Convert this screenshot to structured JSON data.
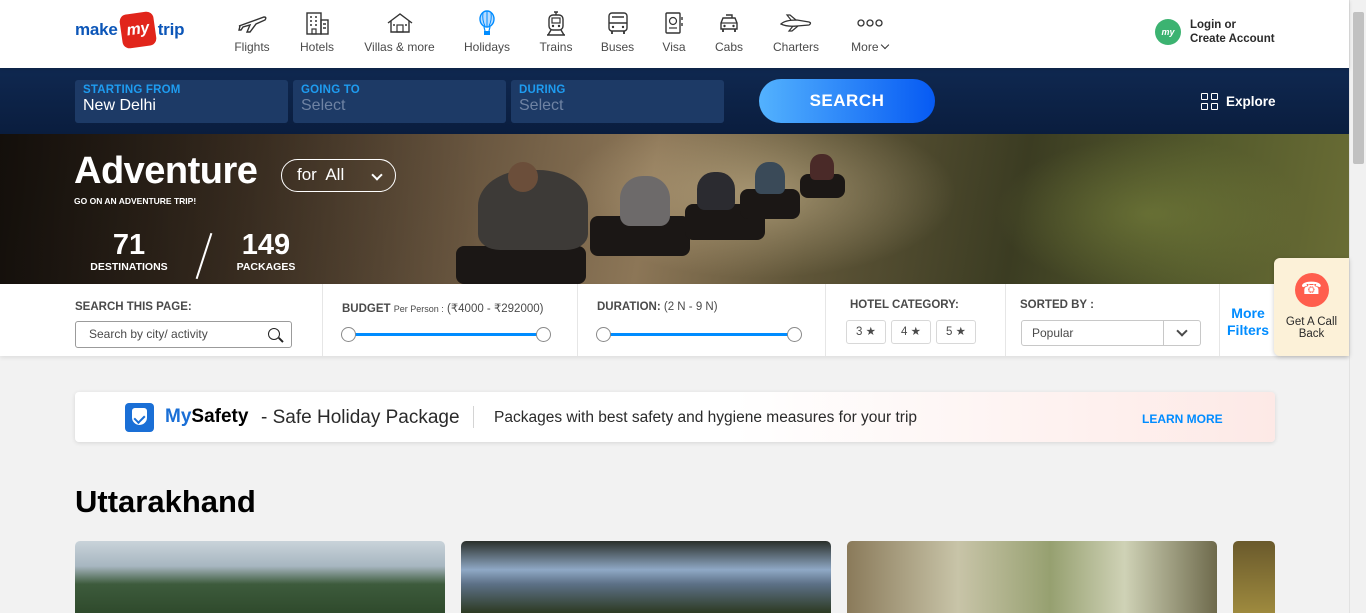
{
  "logo": {
    "make": "make",
    "my": "my",
    "trip": "trip"
  },
  "nav": [
    {
      "label": "Flights",
      "icon": "airplane-icon"
    },
    {
      "label": "Hotels",
      "icon": "hotel-building-icon"
    },
    {
      "label": "Villas & more",
      "icon": "villa-house-icon"
    },
    {
      "label": "Holidays",
      "icon": "hot-air-balloon-icon",
      "active": true
    },
    {
      "label": "Trains",
      "icon": "train-icon"
    },
    {
      "label": "Buses",
      "icon": "bus-icon"
    },
    {
      "label": "Visa",
      "icon": "passport-visa-icon"
    },
    {
      "label": "Cabs",
      "icon": "cab-car-icon"
    },
    {
      "label": "Charters",
      "icon": "charter-jet-icon"
    },
    {
      "label": "More",
      "icon": "more-dots-icon"
    }
  ],
  "login": {
    "line1": "Login or",
    "line2": "Create Account",
    "avatar": "my"
  },
  "search": {
    "from": {
      "label": "STARTING FROM",
      "value": "New Delhi"
    },
    "to": {
      "label": "GOING TO",
      "value": "Select"
    },
    "during": {
      "label": "DURING",
      "value": "Select"
    },
    "button": "SEARCH",
    "explore": "Explore"
  },
  "hero": {
    "title": "Adventure",
    "selector": "for  All",
    "subtitle": "GO ON AN ADVENTURE TRIP!",
    "destinations": {
      "count": "71",
      "label": "DESTINATIONS"
    },
    "packages": {
      "count": "149",
      "label": "PACKAGES"
    }
  },
  "filters": {
    "search_label": "SEARCH THIS PAGE:",
    "search_placeholder": "Search by city/ activity",
    "budget_label": "BUDGET",
    "budget_sub": "Per Person :",
    "budget_range": "(₹4000 - ₹292000)",
    "duration_label": "DURATION:",
    "duration_range": "(2 N - 9 N)",
    "hotel_label": "HOTEL CATEGORY:",
    "hotel_chips": [
      "3 ★",
      "4 ★",
      "5 ★"
    ],
    "sort_label": "SORTED BY :",
    "sort_value": "Popular",
    "more_filters_1": "More",
    "more_filters_2": "Filters"
  },
  "callback": {
    "line1": "Get A Call",
    "line2": "Back"
  },
  "safety": {
    "my": "My",
    "safety": "Safety",
    "pkg": "- Safe Holiday Package",
    "desc": "Packages with best safety and hygiene measures for your trip",
    "cta": "LEARN MORE"
  },
  "region": "Uttarakhand"
}
